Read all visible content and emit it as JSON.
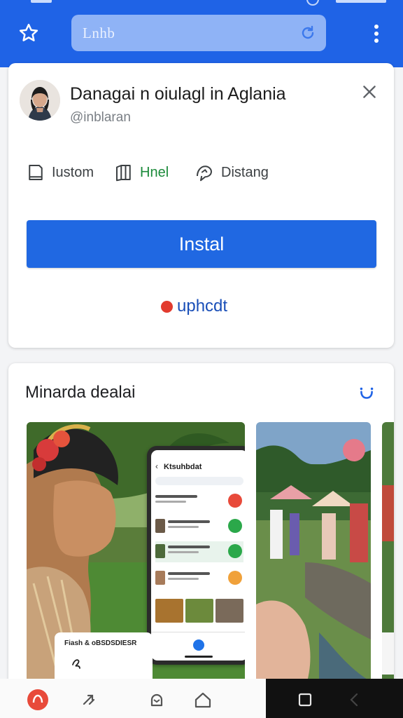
{
  "browser": {
    "url_text": "Lnhb"
  },
  "app": {
    "title": "Danagai n oiulagl in Aglania",
    "handle": "@inblaran"
  },
  "meta": [
    {
      "label": "Iustom",
      "icon": "tablet-icon",
      "color": "#3c4043"
    },
    {
      "label": "Hnel",
      "icon": "book-icon",
      "color": "#1b8a3a"
    },
    {
      "label": "Distang",
      "icon": "chat-icon",
      "color": "#3c4043"
    }
  ],
  "install_label": "Instal",
  "update_label": "uphcdt",
  "section": {
    "title": "Minarda dealai"
  },
  "screenshot1": {
    "phone_title": "Ktsuhbdat",
    "caption": "Fiash & oBSDSDIESR"
  },
  "colors": {
    "brand_blue": "#1f63e6",
    "install_blue": "#2068e2",
    "update_dot": "#e23b2e",
    "green_label": "#1b8a3a"
  }
}
